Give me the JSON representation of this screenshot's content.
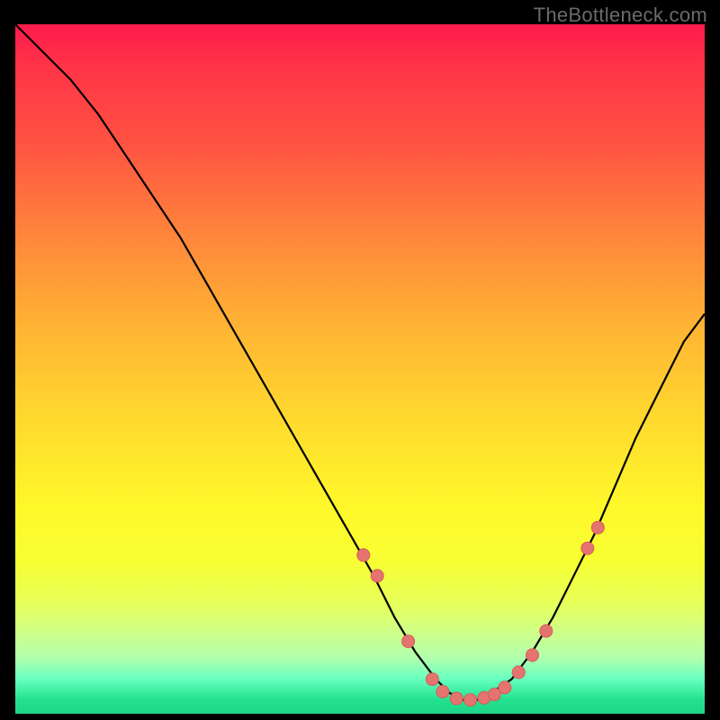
{
  "watermark": "TheBottleneck.com",
  "colors": {
    "curve_stroke": "#000000",
    "dot_fill": "#e4746f",
    "dot_stroke": "#d85c57"
  },
  "chart_data": {
    "type": "line",
    "title": "",
    "xlabel": "",
    "ylabel": "",
    "xlim": [
      0,
      100
    ],
    "ylim": [
      0,
      100
    ],
    "grid": false,
    "series": [
      {
        "name": "bottleneck-curve",
        "x": [
          0,
          4,
          8,
          12,
          16,
          20,
          24,
          28,
          32,
          36,
          40,
          44,
          48,
          52,
          55,
          58,
          61,
          63,
          65,
          67,
          69,
          72,
          75,
          78,
          81,
          84,
          87,
          90,
          94,
          97,
          100
        ],
        "y": [
          100,
          96,
          92,
          87,
          81,
          75,
          69,
          62,
          55,
          48,
          41,
          34,
          27,
          20,
          14,
          9,
          5,
          3,
          2,
          2,
          3,
          5,
          9,
          14,
          20,
          26,
          33,
          40,
          48,
          54,
          58
        ]
      }
    ],
    "dots": {
      "name": "highlight-dots",
      "x": [
        50.5,
        52.5,
        57.0,
        60.5,
        62.0,
        64.0,
        66.0,
        68.0,
        69.5,
        71.0,
        73.0,
        75.0,
        77.0,
        83.0,
        84.5
      ],
      "y": [
        23.0,
        20.0,
        10.5,
        5.0,
        3.2,
        2.2,
        2.0,
        2.3,
        2.8,
        3.8,
        6.0,
        8.5,
        12.0,
        24.0,
        27.0
      ]
    }
  }
}
